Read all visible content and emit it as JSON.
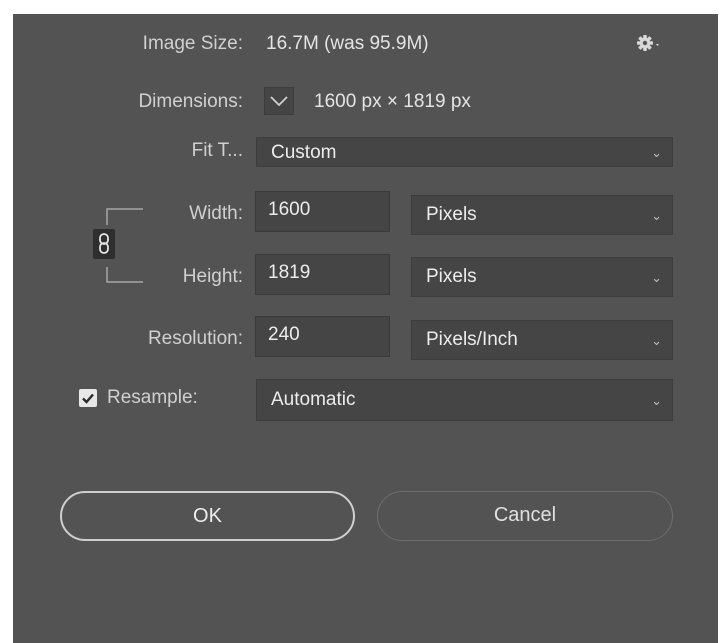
{
  "image_size": {
    "label": "Image Size:",
    "value": "16.7M (was 95.9M)"
  },
  "dimensions": {
    "label": "Dimensions:",
    "value": "1600 px  ×  1819 px"
  },
  "fit_to": {
    "label": "Fit T...",
    "value": "Custom"
  },
  "width": {
    "label": "Width:",
    "value": "1600",
    "unit": "Pixels"
  },
  "height": {
    "label": "Height:",
    "value": "1819",
    "unit": "Pixels"
  },
  "resolution": {
    "label": "Resolution:",
    "value": "240",
    "unit": "Pixels/Inch"
  },
  "resample": {
    "label": "Resample:",
    "checked": true,
    "value": "Automatic"
  },
  "buttons": {
    "ok": "OK",
    "cancel": "Cancel"
  },
  "colors": {
    "dialog_bg": "#535353",
    "field_bg": "#454545",
    "text": "#d6d6d6"
  }
}
